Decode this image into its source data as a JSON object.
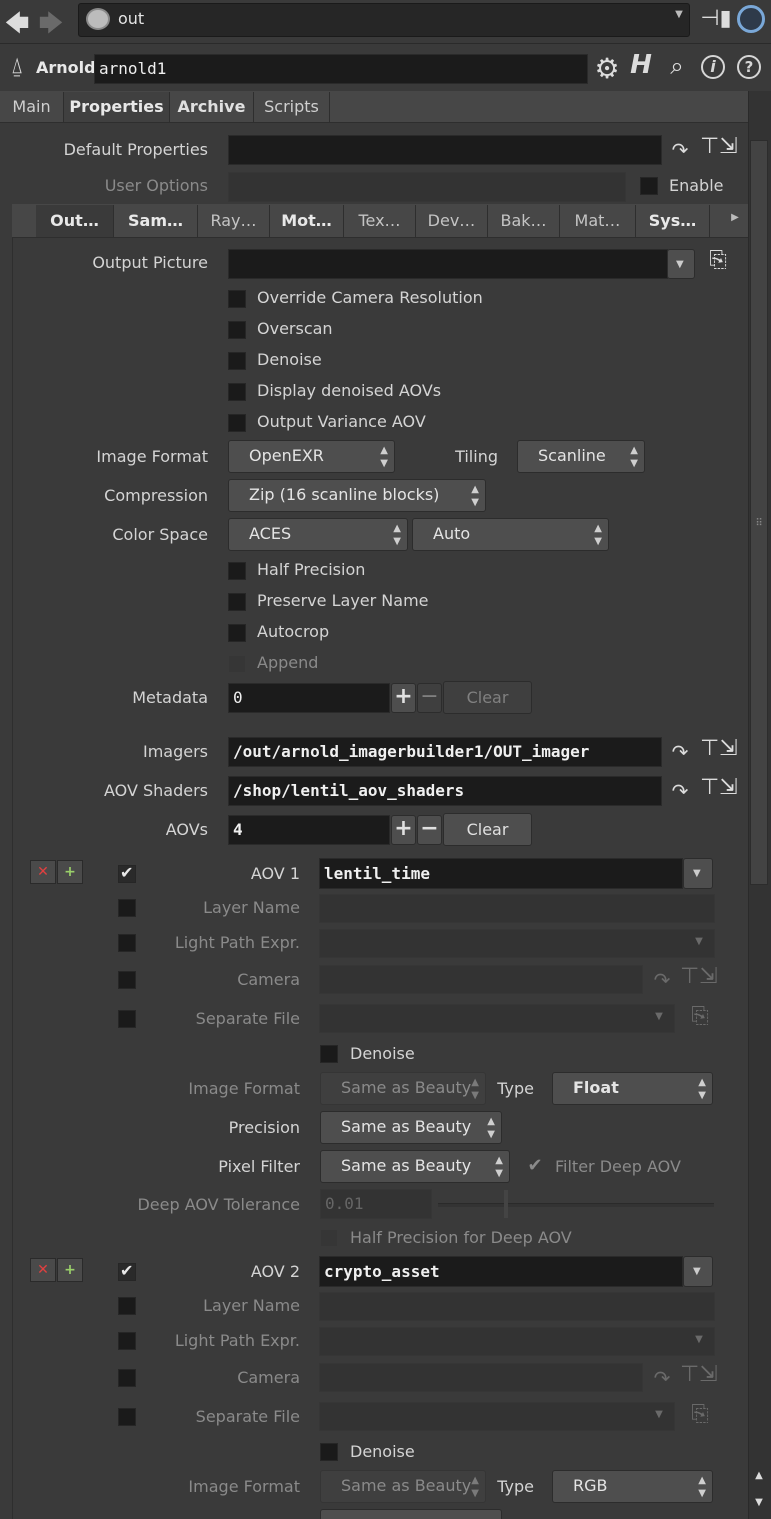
{
  "toolbar": {
    "path": "out"
  },
  "node": {
    "type_label": "Arnold",
    "name": "arnold1"
  },
  "tabs": [
    "Main",
    "Properties",
    "Archive",
    "Scripts"
  ],
  "default_properties": {
    "label": "Default Properties",
    "value": ""
  },
  "user_options": {
    "label": "User Options",
    "enable_label": "Enable"
  },
  "subtabs": [
    "Out…",
    "Sam…",
    "Ray…",
    "Mot…",
    "Tex…",
    "Dev…",
    "Bak…",
    "Mat…",
    "Sys…"
  ],
  "output": {
    "picture_label": "Output Picture",
    "checks": [
      "Override Camera Resolution",
      "Overscan",
      "Denoise",
      "Display denoised AOVs",
      "Output Variance AOV"
    ],
    "image_format_label": "Image Format",
    "image_format": "OpenEXR",
    "tiling_label": "Tiling",
    "tiling": "Scanline",
    "compression_label": "Compression",
    "compression": "Zip (16 scanline blocks)",
    "color_space_label": "Color Space",
    "color_space": "ACES",
    "color_space2": "Auto",
    "checks2": [
      "Half Precision",
      "Preserve Layer Name",
      "Autocrop",
      "Append"
    ],
    "metadata_label": "Metadata",
    "metadata": "0",
    "clear": "Clear",
    "imagers_label": "Imagers",
    "imagers": "/out/arnold_imagerbuilder1/OUT_imager",
    "aov_shaders_label": "AOV Shaders",
    "aov_shaders": "/shop/lentil_aov_shaders",
    "aovs_label": "AOVs",
    "aovs": "4"
  },
  "aov_labels": {
    "layer_name": "Layer Name",
    "lpe": "Light Path Expr.",
    "camera": "Camera",
    "separate_file": "Separate File",
    "denoise": "Denoise",
    "image_format": "Image Format",
    "type": "Type",
    "precision": "Precision",
    "pixel_filter": "Pixel Filter",
    "filter_deep": "Filter Deep AOV",
    "deep_tol": "Deep AOV Tolerance",
    "half_deep": "Half Precision for Deep AOV"
  },
  "aov1": {
    "label": "AOV 1",
    "name": "lentil_time",
    "image_format": "Same as Beauty",
    "type": "Float",
    "precision": "Same as Beauty",
    "pixel_filter": "Same as Beauty",
    "deep_tol": "0.01"
  },
  "aov2": {
    "label": "AOV 2",
    "name": "crypto_asset",
    "image_format": "Same as Beauty",
    "type": "RGB"
  }
}
